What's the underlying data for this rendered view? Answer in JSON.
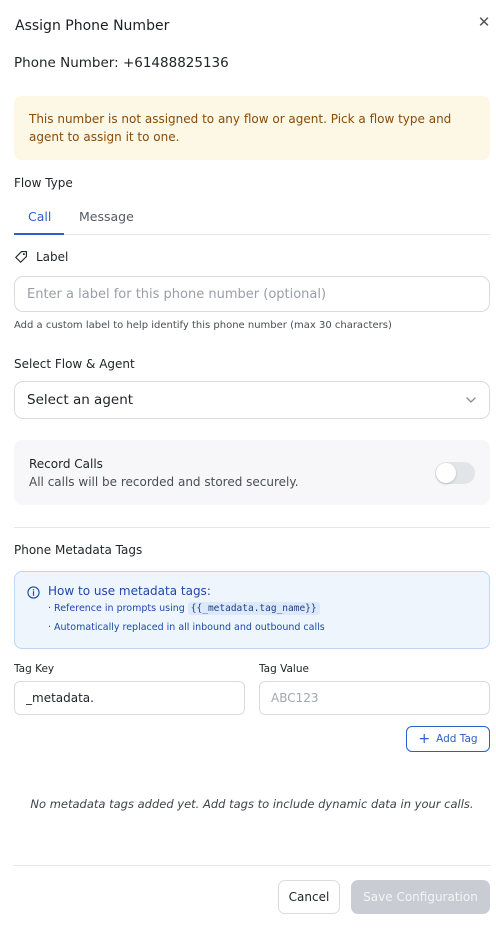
{
  "dialog": {
    "title": "Assign Phone Number",
    "close_icon": "close-icon",
    "phone_number_text": "Phone Number: +61488825136"
  },
  "alert": {
    "message": "This number is not assigned to any flow or agent. Pick a flow type and agent to assign it to one."
  },
  "flow_type": {
    "label": "Flow Type",
    "tabs": [
      {
        "label": "Call",
        "active": true
      },
      {
        "label": "Message",
        "active": false
      }
    ]
  },
  "label_field": {
    "icon": "tag-icon",
    "label": "Label",
    "placeholder": "Enter a label for this phone number (optional)",
    "value": "",
    "help": "Add a custom label to help identify this phone number (max 30 characters)"
  },
  "agent_select": {
    "label": "Select Flow & Agent",
    "selected": "Select an agent",
    "icon": "chevron-down-icon"
  },
  "record_calls": {
    "title": "Record Calls",
    "description": "All calls will be recorded and stored securely.",
    "enabled": false
  },
  "metadata": {
    "section_title": "Phone Metadata Tags",
    "info": {
      "icon": "info-icon",
      "title": "How to use metadata tags:",
      "line1_prefix": "· Reference in prompts using",
      "line1_code": "{{_metadata.tag_name}}",
      "line2": "· Automatically replaced in all inbound and outbound calls"
    },
    "tag_key": {
      "label": "Tag Key",
      "value": "_metadata."
    },
    "tag_value": {
      "label": "Tag Value",
      "placeholder": "ABC123",
      "value": ""
    },
    "add_tag_label": "Add Tag",
    "empty_message": "No metadata tags added yet. Add tags to include dynamic data in your calls."
  },
  "footer": {
    "cancel_label": "Cancel",
    "save_label": "Save Configuration"
  },
  "colors": {
    "accent": "#2b5fc7",
    "alert_bg": "#fdf7e6",
    "alert_text": "#8a4b06",
    "info_bg": "#eef5fd",
    "info_text": "#1e49a8",
    "disabled_button": "#c9ccd3"
  }
}
